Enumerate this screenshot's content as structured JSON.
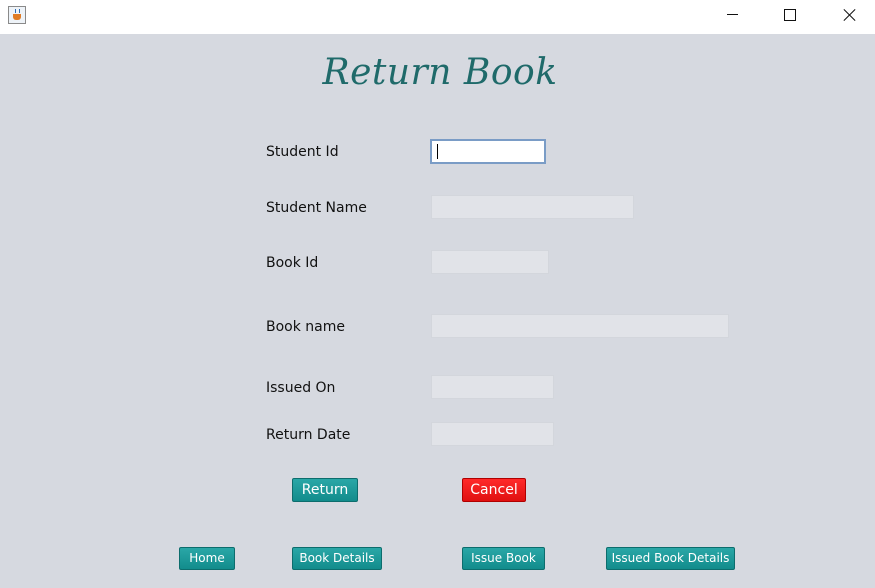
{
  "form": {
    "title": "Return Book",
    "fields": [
      {
        "label": "Student Id",
        "value": ""
      },
      {
        "label": "Student Name",
        "value": ""
      },
      {
        "label": "Book Id",
        "value": ""
      },
      {
        "label": "Book name",
        "value": ""
      },
      {
        "label": "Issued On",
        "value": ""
      },
      {
        "label": "Return Date",
        "value": ""
      }
    ],
    "return_label": "Return",
    "cancel_label": "Cancel"
  },
  "nav": {
    "home_label": "Home",
    "book_details_label": "Book Details",
    "issue_book_label": "Issue Book",
    "issued_book_details_label": "Issued Book Details"
  },
  "icons": {
    "app": "java-cup-icon",
    "minimize": "minimize-icon",
    "maximize": "maximize-icon",
    "close": "close-icon"
  },
  "colors": {
    "background": "#d6d9e0",
    "heading": "#1f6a6a",
    "primary_button": "#1a9a9a",
    "cancel_button": "#f01818"
  }
}
